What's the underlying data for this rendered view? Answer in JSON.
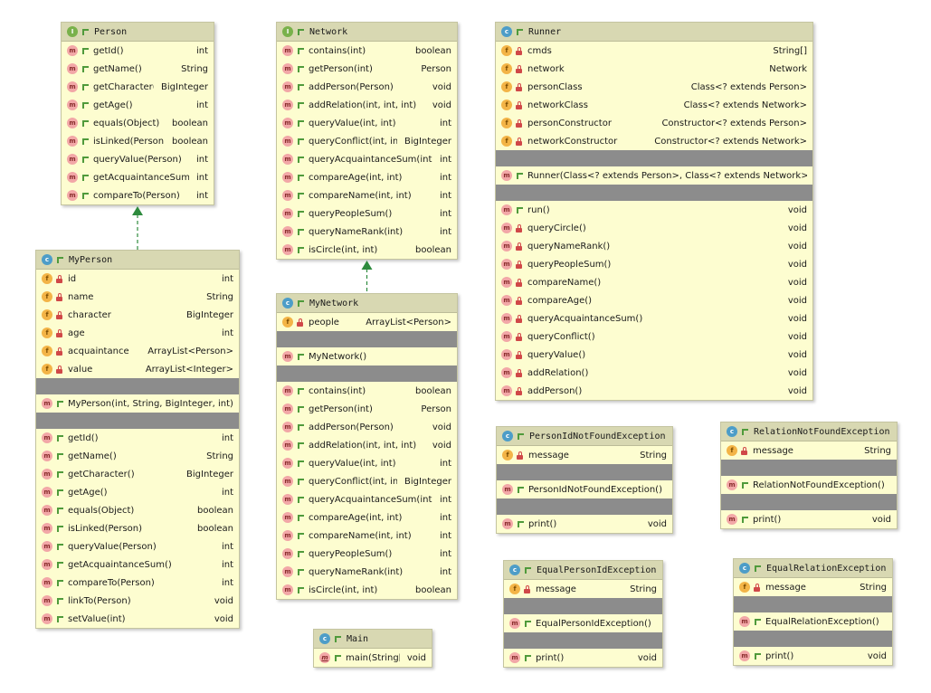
{
  "classes": [
    {
      "key": "person",
      "name": "Person",
      "kind": "interface",
      "members": [
        {
          "sec": "methods",
          "vis": "public",
          "sig": "getId()",
          "type": "int"
        },
        {
          "sec": "methods",
          "vis": "public",
          "sig": "getName()",
          "type": "String"
        },
        {
          "sec": "methods",
          "vis": "public",
          "sig": "getCharacter()",
          "type": "BigInteger"
        },
        {
          "sec": "methods",
          "vis": "public",
          "sig": "getAge()",
          "type": "int"
        },
        {
          "sec": "methods",
          "vis": "public",
          "sig": "equals(Object)",
          "type": "boolean"
        },
        {
          "sec": "methods",
          "vis": "public",
          "sig": "isLinked(Person)",
          "type": "boolean"
        },
        {
          "sec": "methods",
          "vis": "public",
          "sig": "queryValue(Person)",
          "type": "int"
        },
        {
          "sec": "methods",
          "vis": "public",
          "sig": "getAcquaintanceSum()",
          "type": "int"
        },
        {
          "sec": "methods",
          "vis": "public",
          "sig": "compareTo(Person)",
          "type": "int"
        }
      ]
    },
    {
      "key": "network",
      "name": "Network",
      "kind": "interface",
      "members": [
        {
          "sec": "methods",
          "vis": "public",
          "sig": "contains(int)",
          "type": "boolean"
        },
        {
          "sec": "methods",
          "vis": "public",
          "sig": "getPerson(int)",
          "type": "Person"
        },
        {
          "sec": "methods",
          "vis": "public",
          "sig": "addPerson(Person)",
          "type": "void"
        },
        {
          "sec": "methods",
          "vis": "public",
          "sig": "addRelation(int, int, int)",
          "type": "void"
        },
        {
          "sec": "methods",
          "vis": "public",
          "sig": "queryValue(int, int)",
          "type": "int"
        },
        {
          "sec": "methods",
          "vis": "public",
          "sig": "queryConflict(int, int)",
          "type": "BigInteger"
        },
        {
          "sec": "methods",
          "vis": "public",
          "sig": "queryAcquaintanceSum(int)",
          "type": "int"
        },
        {
          "sec": "methods",
          "vis": "public",
          "sig": "compareAge(int, int)",
          "type": "int"
        },
        {
          "sec": "methods",
          "vis": "public",
          "sig": "compareName(int, int)",
          "type": "int"
        },
        {
          "sec": "methods",
          "vis": "public",
          "sig": "queryPeopleSum()",
          "type": "int"
        },
        {
          "sec": "methods",
          "vis": "public",
          "sig": "queryNameRank(int)",
          "type": "int"
        },
        {
          "sec": "methods",
          "vis": "public",
          "sig": "isCircle(int, int)",
          "type": "boolean"
        }
      ]
    },
    {
      "key": "runner",
      "name": "Runner",
      "kind": "class",
      "members": [
        {
          "sec": "fields",
          "vis": "private",
          "sig": "cmds",
          "type": "String[]"
        },
        {
          "sec": "fields",
          "vis": "private",
          "sig": "network",
          "type": "Network"
        },
        {
          "sec": "fields",
          "vis": "private",
          "sig": "personClass",
          "type": "Class<? extends Person>"
        },
        {
          "sec": "fields",
          "vis": "private",
          "sig": "networkClass",
          "type": "Class<? extends Network>"
        },
        {
          "sec": "fields",
          "vis": "private",
          "sig": "personConstructor",
          "type": "Constructor<? extends Person>"
        },
        {
          "sec": "fields",
          "vis": "private",
          "sig": "networkConstructor",
          "type": "Constructor<? extends Network>"
        },
        {
          "sec": "ctors",
          "vis": "public",
          "sig": "Runner(Class<? extends Person>, Class<? extends Network>)",
          "type": ""
        },
        {
          "sec": "methods",
          "vis": "public",
          "sig": "run()",
          "type": "void"
        },
        {
          "sec": "methods",
          "vis": "private",
          "sig": "queryCircle()",
          "type": "void"
        },
        {
          "sec": "methods",
          "vis": "private",
          "sig": "queryNameRank()",
          "type": "void"
        },
        {
          "sec": "methods",
          "vis": "private",
          "sig": "queryPeopleSum()",
          "type": "void"
        },
        {
          "sec": "methods",
          "vis": "private",
          "sig": "compareName()",
          "type": "void"
        },
        {
          "sec": "methods",
          "vis": "private",
          "sig": "compareAge()",
          "type": "void"
        },
        {
          "sec": "methods",
          "vis": "private",
          "sig": "queryAcquaintanceSum()",
          "type": "void"
        },
        {
          "sec": "methods",
          "vis": "private",
          "sig": "queryConflict()",
          "type": "void"
        },
        {
          "sec": "methods",
          "vis": "private",
          "sig": "queryValue()",
          "type": "void"
        },
        {
          "sec": "methods",
          "vis": "private",
          "sig": "addRelation()",
          "type": "void"
        },
        {
          "sec": "methods",
          "vis": "private",
          "sig": "addPerson()",
          "type": "void"
        }
      ]
    },
    {
      "key": "myperson",
      "name": "MyPerson",
      "kind": "class",
      "members": [
        {
          "sec": "fields",
          "vis": "private",
          "sig": "id",
          "type": "int"
        },
        {
          "sec": "fields",
          "vis": "private",
          "sig": "name",
          "type": "String"
        },
        {
          "sec": "fields",
          "vis": "private",
          "sig": "character",
          "type": "BigInteger"
        },
        {
          "sec": "fields",
          "vis": "private",
          "sig": "age",
          "type": "int"
        },
        {
          "sec": "fields",
          "vis": "private",
          "sig": "acquaintance",
          "type": "ArrayList<Person>"
        },
        {
          "sec": "fields",
          "vis": "private",
          "sig": "value",
          "type": "ArrayList<Integer>"
        },
        {
          "sec": "ctors",
          "vis": "public",
          "sig": "MyPerson(int, String, BigInteger, int)",
          "type": ""
        },
        {
          "sec": "methods",
          "vis": "public",
          "sig": "getId()",
          "type": "int"
        },
        {
          "sec": "methods",
          "vis": "public",
          "sig": "getName()",
          "type": "String"
        },
        {
          "sec": "methods",
          "vis": "public",
          "sig": "getCharacter()",
          "type": "BigInteger"
        },
        {
          "sec": "methods",
          "vis": "public",
          "sig": "getAge()",
          "type": "int"
        },
        {
          "sec": "methods",
          "vis": "public",
          "sig": "equals(Object)",
          "type": "boolean"
        },
        {
          "sec": "methods",
          "vis": "public",
          "sig": "isLinked(Person)",
          "type": "boolean"
        },
        {
          "sec": "methods",
          "vis": "public",
          "sig": "queryValue(Person)",
          "type": "int"
        },
        {
          "sec": "methods",
          "vis": "public",
          "sig": "getAcquaintanceSum()",
          "type": "int"
        },
        {
          "sec": "methods",
          "vis": "public",
          "sig": "compareTo(Person)",
          "type": "int"
        },
        {
          "sec": "methods",
          "vis": "public",
          "sig": "linkTo(Person)",
          "type": "void"
        },
        {
          "sec": "methods",
          "vis": "public",
          "sig": "setValue(int)",
          "type": "void"
        }
      ]
    },
    {
      "key": "mynetwork",
      "name": "MyNetwork",
      "kind": "class",
      "members": [
        {
          "sec": "fields",
          "vis": "private",
          "sig": "people",
          "type": "ArrayList<Person>"
        },
        {
          "sec": "ctors",
          "vis": "public",
          "sig": "MyNetwork()",
          "type": ""
        },
        {
          "sec": "methods",
          "vis": "public",
          "sig": "contains(int)",
          "type": "boolean"
        },
        {
          "sec": "methods",
          "vis": "public",
          "sig": "getPerson(int)",
          "type": "Person"
        },
        {
          "sec": "methods",
          "vis": "public",
          "sig": "addPerson(Person)",
          "type": "void"
        },
        {
          "sec": "methods",
          "vis": "public",
          "sig": "addRelation(int, int, int)",
          "type": "void"
        },
        {
          "sec": "methods",
          "vis": "public",
          "sig": "queryValue(int, int)",
          "type": "int"
        },
        {
          "sec": "methods",
          "vis": "public",
          "sig": "queryConflict(int, int)",
          "type": "BigInteger"
        },
        {
          "sec": "methods",
          "vis": "public",
          "sig": "queryAcquaintanceSum(int)",
          "type": "int"
        },
        {
          "sec": "methods",
          "vis": "public",
          "sig": "compareAge(int, int)",
          "type": "int"
        },
        {
          "sec": "methods",
          "vis": "public",
          "sig": "compareName(int, int)",
          "type": "int"
        },
        {
          "sec": "methods",
          "vis": "public",
          "sig": "queryPeopleSum()",
          "type": "int"
        },
        {
          "sec": "methods",
          "vis": "public",
          "sig": "queryNameRank(int)",
          "type": "int"
        },
        {
          "sec": "methods",
          "vis": "public",
          "sig": "isCircle(int, int)",
          "type": "boolean"
        }
      ]
    },
    {
      "key": "main",
      "name": "Main",
      "kind": "class",
      "members": [
        {
          "sec": "methods",
          "vis": "public",
          "static": true,
          "sig": "main(String[])",
          "type": "void"
        }
      ]
    },
    {
      "key": "personidnotfoundexception",
      "name": "PersonIdNotFoundException",
      "kind": "class",
      "members": [
        {
          "sec": "fields",
          "vis": "private",
          "sig": "message",
          "type": "String"
        },
        {
          "sec": "ctors",
          "vis": "public",
          "sig": "PersonIdNotFoundException()",
          "type": ""
        },
        {
          "sec": "methods",
          "vis": "public",
          "sig": "print()",
          "type": "void"
        }
      ]
    },
    {
      "key": "relationnotfoundexception",
      "name": "RelationNotFoundException",
      "kind": "class",
      "members": [
        {
          "sec": "fields",
          "vis": "private",
          "sig": "message",
          "type": "String"
        },
        {
          "sec": "ctors",
          "vis": "public",
          "sig": "RelationNotFoundException()",
          "type": ""
        },
        {
          "sec": "methods",
          "vis": "public",
          "sig": "print()",
          "type": "void"
        }
      ]
    },
    {
      "key": "equalpersonidexception",
      "name": "EqualPersonIdException",
      "kind": "class",
      "members": [
        {
          "sec": "fields",
          "vis": "private",
          "sig": "message",
          "type": "String"
        },
        {
          "sec": "ctors",
          "vis": "public",
          "sig": "EqualPersonIdException()",
          "type": ""
        },
        {
          "sec": "methods",
          "vis": "public",
          "sig": "print()",
          "type": "void"
        }
      ]
    },
    {
      "key": "equalrelationexception",
      "name": "EqualRelationException",
      "kind": "class",
      "members": [
        {
          "sec": "fields",
          "vis": "private",
          "sig": "message",
          "type": "String"
        },
        {
          "sec": "ctors",
          "vis": "public",
          "sig": "EqualRelationException()",
          "type": ""
        },
        {
          "sec": "methods",
          "vis": "public",
          "sig": "print()",
          "type": "void"
        }
      ]
    }
  ],
  "relations": [
    {
      "from": "myperson",
      "to": "person",
      "type": "implements"
    },
    {
      "from": "mynetwork",
      "to": "network",
      "type": "implements"
    }
  ],
  "colors": {
    "box_bg": "#fdfdd0",
    "header_bg": "#d8d8b2",
    "separator": "#8c8c8c",
    "implements_line": "#2e8b3e",
    "method_icon": "#f2a7a7",
    "field_icon": "#f3b447",
    "class_icon": "#4d9dc8",
    "interface_icon": "#79b14b",
    "public_vis": "#4f9a3b",
    "private_vis": "#d04848"
  },
  "icon_glyphs": {
    "method": "m",
    "field": "f",
    "class": "c",
    "interface": "I"
  }
}
